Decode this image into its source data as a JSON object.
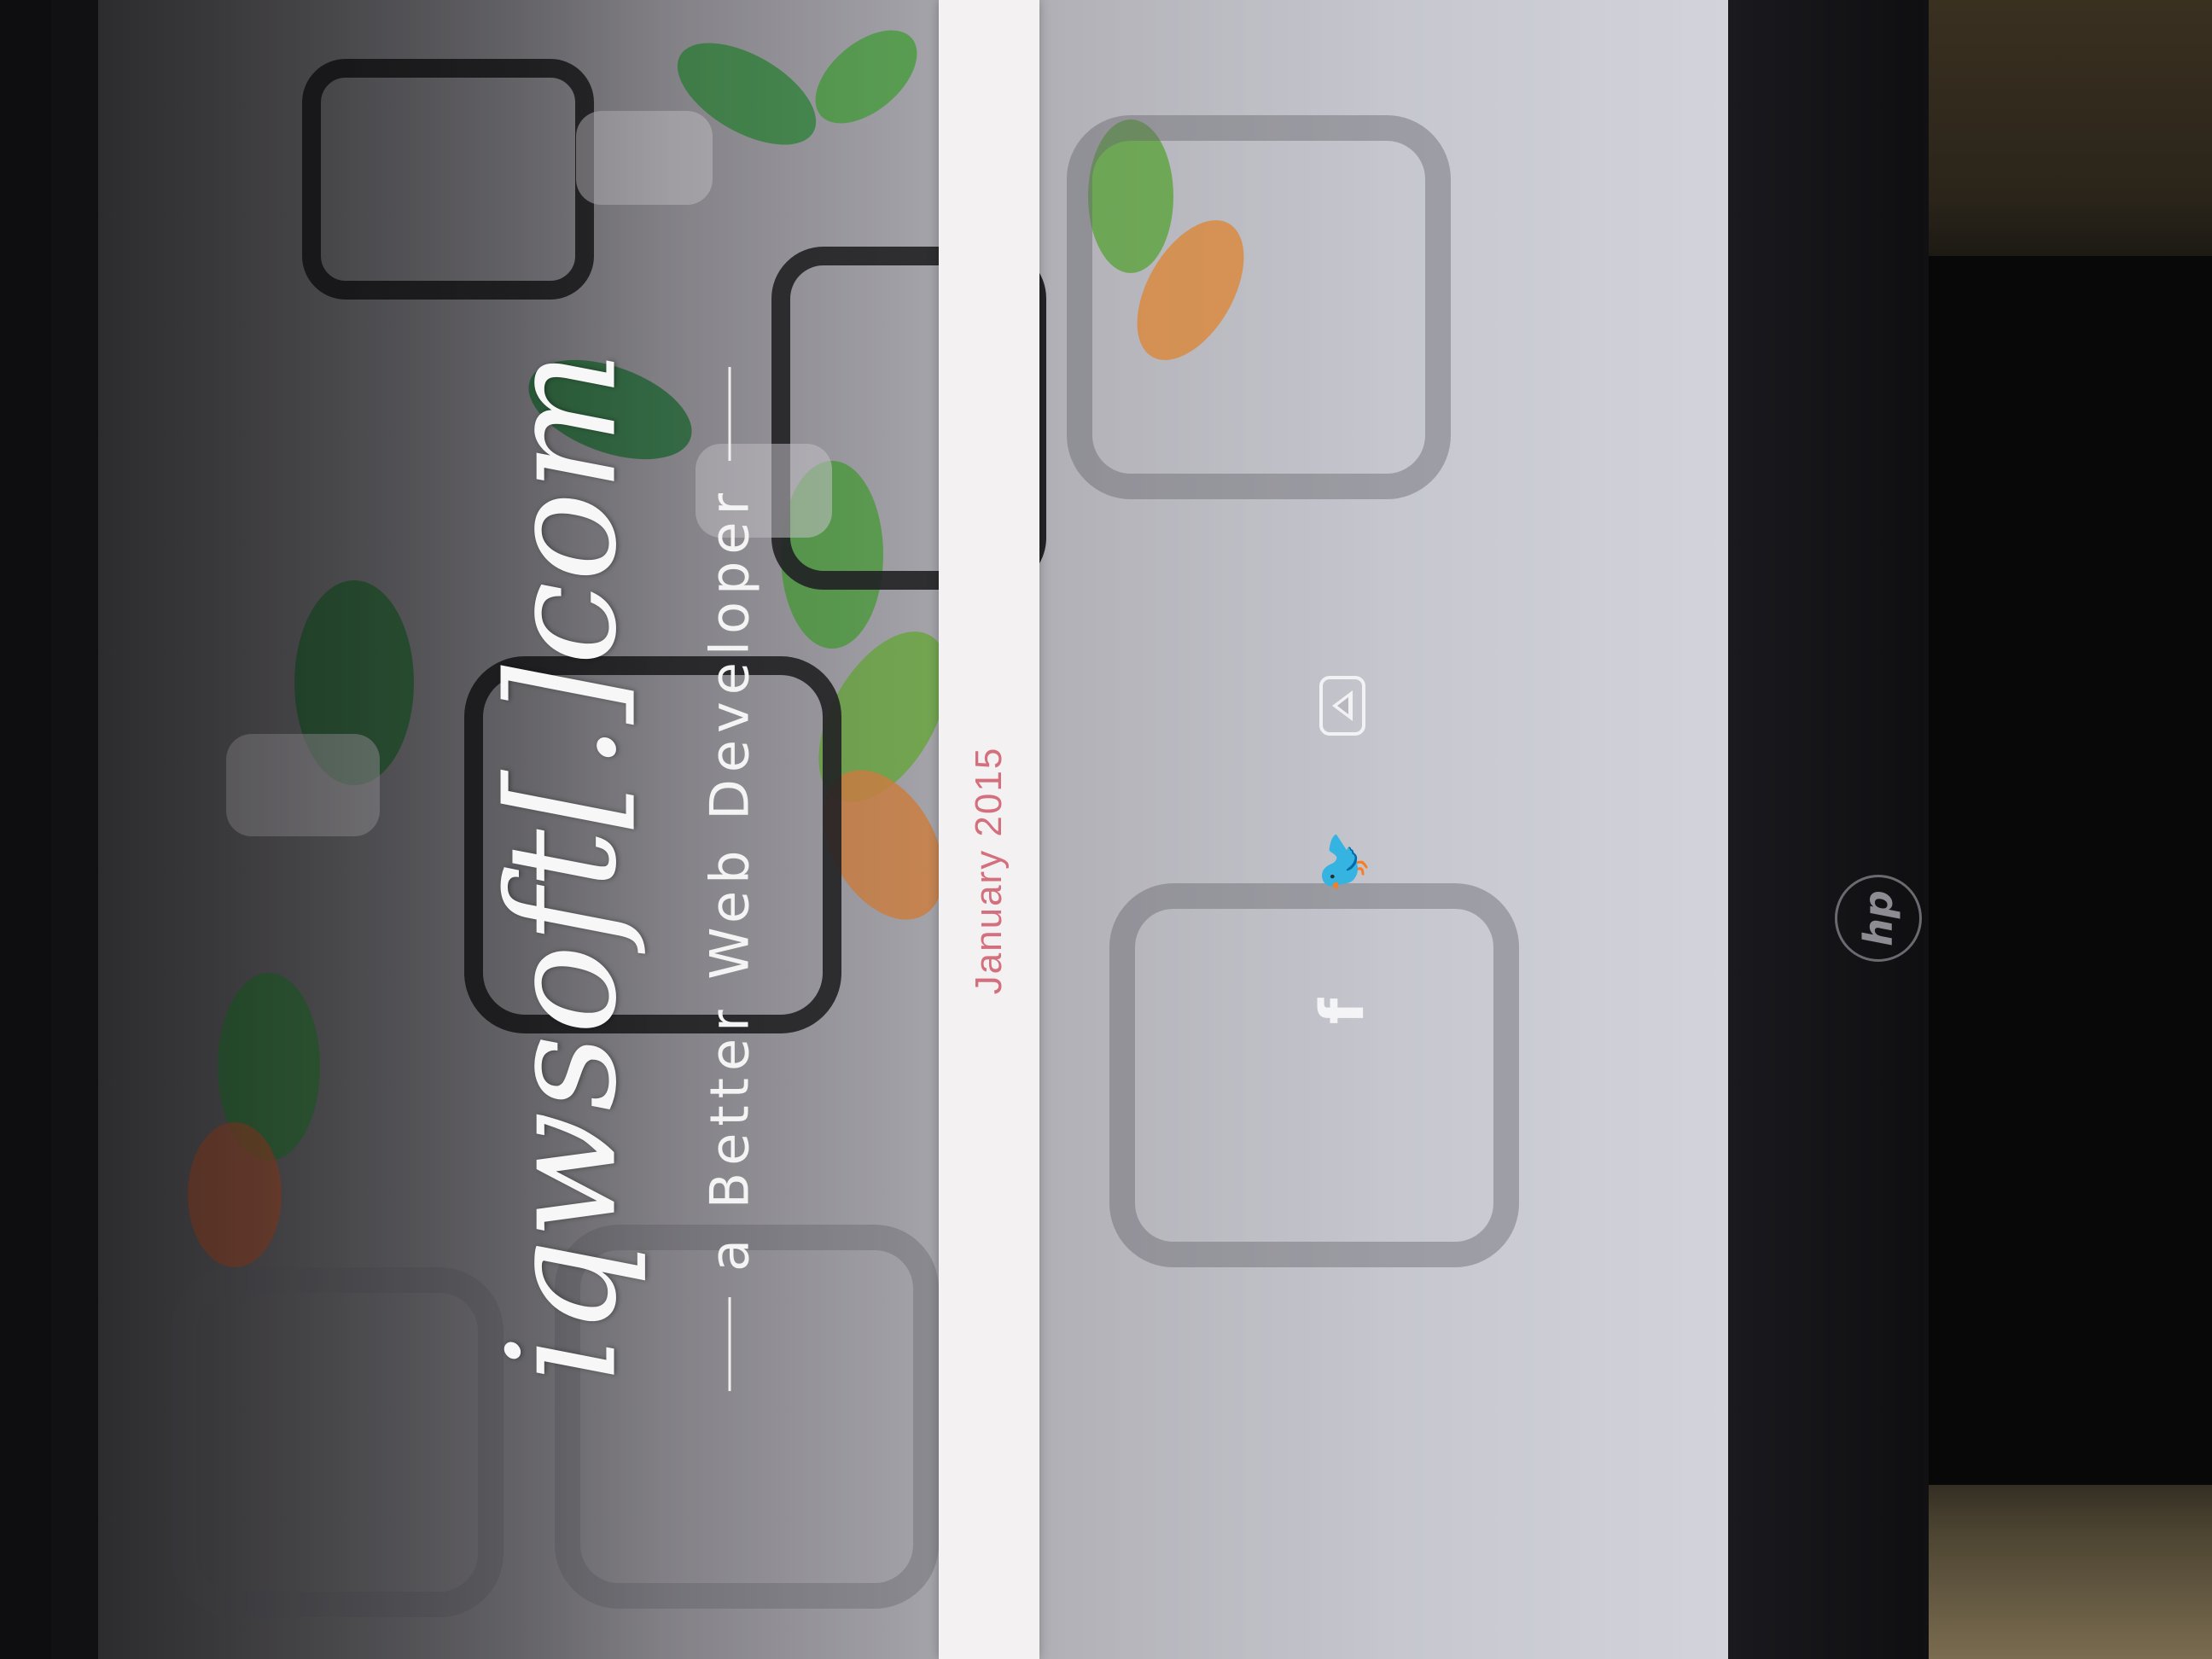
{
  "site": {
    "logo_text": "iqwsoft[.]com",
    "tagline": "a Better Web Developer",
    "date_label": "January 2015"
  },
  "social": {
    "icons": [
      "youtube-icon",
      "twitter-icon",
      "facebook-icon"
    ],
    "youtube_glyph": "",
    "twitter_glyph": "🐦",
    "facebook_glyph": "f"
  },
  "device": {
    "brand": "hp"
  },
  "colors": {
    "date_accent": "#d4707e",
    "strip_bg": "#f3f1f1",
    "text_light": "#f7f7f7"
  }
}
